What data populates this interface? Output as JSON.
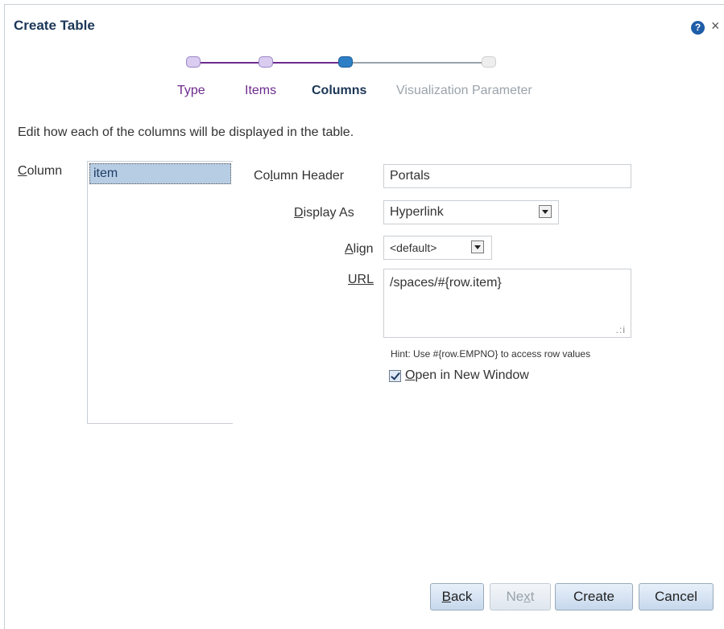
{
  "dialog": {
    "title": "Create Table",
    "help_glyph": "?",
    "close_glyph": "×"
  },
  "train": {
    "steps": [
      {
        "label": "Type",
        "state": "visited"
      },
      {
        "label": "Items",
        "state": "visited"
      },
      {
        "label": "Columns",
        "state": "current"
      },
      {
        "label": "Visualization Parameter",
        "state": "future"
      }
    ]
  },
  "instructions": "Edit how each of the columns will be displayed in the table.",
  "column": {
    "label_first": "C",
    "label_rest": "olumn",
    "items": [
      "item"
    ]
  },
  "form": {
    "column_header": {
      "label_pre": "Co",
      "label_ul": "l",
      "label_post": "umn Header",
      "value": "Portals"
    },
    "display_as": {
      "label_ul": "D",
      "label_post": "isplay As",
      "value": "Hyperlink"
    },
    "align": {
      "label_ul": "A",
      "label_post": "lign",
      "value": "<default>"
    },
    "url": {
      "label": "URL",
      "value": "/spaces/#{row.item}",
      "grip": ".:i"
    },
    "hint": "Hint: Use #{row.EMPNO} to access row values",
    "open_new_window": {
      "label_ul": "O",
      "label_post": "pen in New Window",
      "checked": true
    }
  },
  "buttons": {
    "back": {
      "ul": "B",
      "rest": "ack"
    },
    "next": {
      "pre": "Ne",
      "ul": "x",
      "rest": "t"
    },
    "create": "Create",
    "cancel": "Cancel"
  },
  "colors": {
    "title": "#1b3656",
    "visited": "#6d2b8f",
    "current": "#1b3656",
    "future": "#9aa3ab",
    "selected_row": "#b7cde4"
  }
}
